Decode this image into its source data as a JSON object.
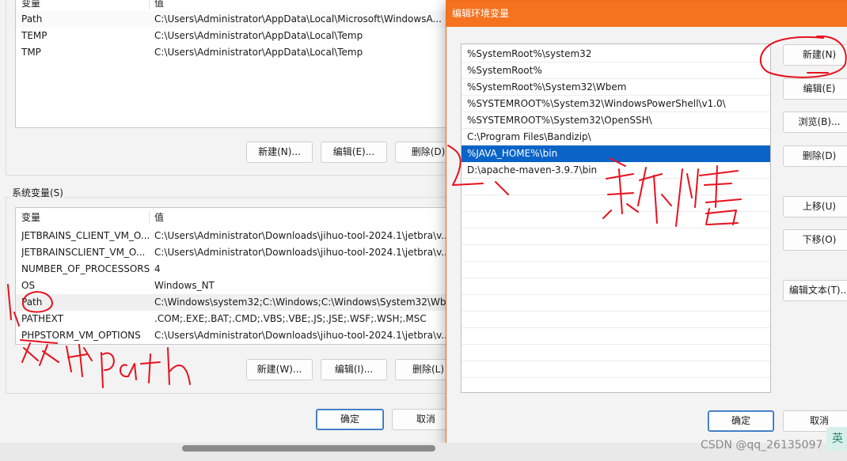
{
  "user_vars": {
    "header": {
      "name": "变量",
      "value": "值"
    },
    "rows": [
      {
        "name": "Path",
        "value": "C:\\Users\\Administrator\\AppData\\Local\\Microsoft\\WindowsA..."
      },
      {
        "name": "TEMP",
        "value": "C:\\Users\\Administrator\\AppData\\Local\\Temp"
      },
      {
        "name": "TMP",
        "value": "C:\\Users\\Administrator\\AppData\\Local\\Temp"
      }
    ],
    "new_label": "新建(N)...",
    "edit_label": "编辑(E)...",
    "delete_label": "删除(D)"
  },
  "system_vars": {
    "title": "系统变量(S)",
    "header": {
      "name": "变量",
      "value": "值"
    },
    "rows": [
      {
        "name": "JETBRAINS_CLIENT_VM_O...",
        "value": "C:\\Users\\Administrator\\Downloads\\jihuo-tool-2024.1\\jetbra\\v..."
      },
      {
        "name": "JETBRAINSCLIENT_VM_O...",
        "value": "C:\\Users\\Administrator\\Downloads\\jihuo-tool-2024.1\\jetbra\\v..."
      },
      {
        "name": "NUMBER_OF_PROCESSORS",
        "value": "4"
      },
      {
        "name": "OS",
        "value": "Windows_NT"
      },
      {
        "name": "Path",
        "value": "C:\\Windows\\system32;C:\\Windows;C:\\Windows\\System32\\Wb..."
      },
      {
        "name": "PATHEXT",
        "value": ".COM;.EXE;.BAT;.CMD;.VBS;.VBE;.JS;.JSE;.WSF;.WSH;.MSC"
      },
      {
        "name": "PHPSTORM_VM_OPTIONS",
        "value": "C:\\Users\\Administrator\\Downloads\\jihuo-tool-2024.1\\jetbra\\v..."
      }
    ],
    "new_label": "新建(W)...",
    "edit_label": "编辑(I)...",
    "delete_label": "删除(L)"
  },
  "main_buttons": {
    "ok": "确定",
    "cancel": "取消"
  },
  "edit_dialog": {
    "title": "编辑环境变量",
    "paths": [
      "%SystemRoot%\\system32",
      "%SystemRoot%",
      "%SystemRoot%\\System32\\Wbem",
      "%SYSTEMROOT%\\System32\\WindowsPowerShell\\v1.0\\",
      "%SYSTEMROOT%\\System32\\OpenSSH\\",
      "C:\\Program Files\\Bandizip\\",
      "%JAVA_HOME%\\bin",
      "D:\\apache-maven-3.9.7\\bin"
    ],
    "selected_index": 6,
    "buttons": {
      "new": "新建(N)",
      "edit": "编辑(E)",
      "browse": "浏览(B)...",
      "delete": "删除(D)",
      "move_up": "上移(U)",
      "move_down": "下移(O)",
      "edit_text": "编辑文本(T)...",
      "ok": "确定",
      "cancel": "取消"
    }
  },
  "annotations": {
    "step1": "1、双击path",
    "step2": "2、新增",
    "color": "#e8101e"
  },
  "watermark": "CSDN @qq_26135097",
  "ime_label": "英",
  "colors": {
    "accent_title": "#f5731f",
    "selection": "#0a64c8"
  }
}
